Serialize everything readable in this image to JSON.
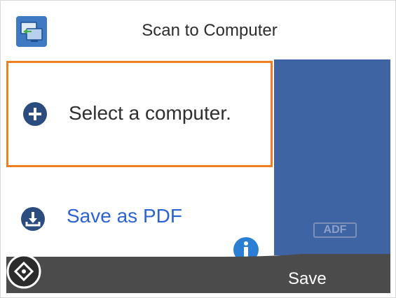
{
  "header": {
    "title": "Scan to Computer",
    "icon": "scan-to-computer-icon"
  },
  "list": {
    "items": [
      {
        "label": "Select a computer.",
        "icon": "plus-circle-icon",
        "selected": true
      },
      {
        "label": "Save as PDF",
        "icon": "download-icon",
        "selected": false
      }
    ]
  },
  "side": {
    "adf_label": "ADF"
  },
  "footer": {
    "save_label": "Save",
    "start_icon": "start-diamond-icon"
  },
  "colors": {
    "accent_orange": "#f07f1f",
    "panel_blue": "#3e64a4",
    "link_blue": "#2c63d4",
    "bar_dark": "#4b4b4b"
  }
}
